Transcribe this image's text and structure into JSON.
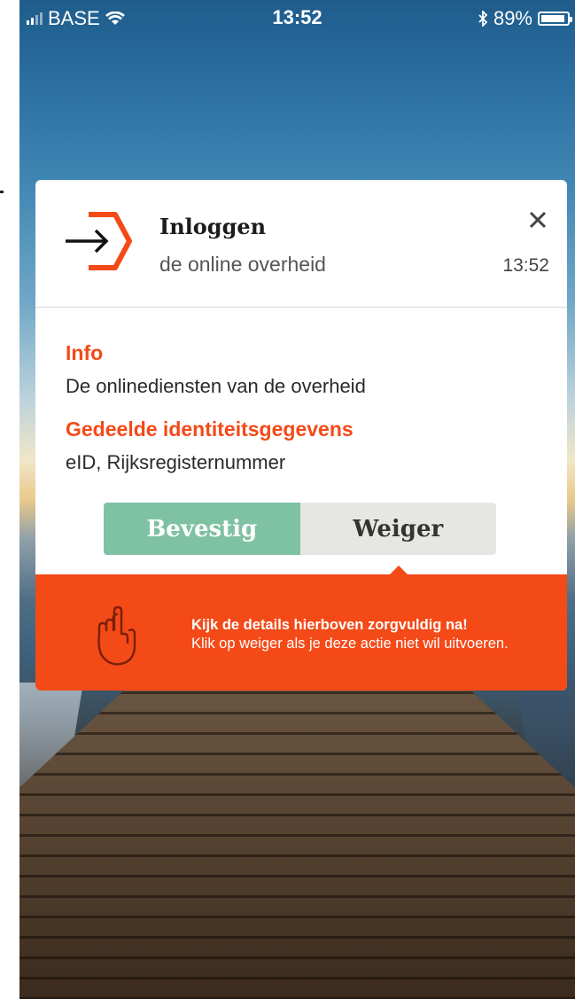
{
  "status_bar": {
    "carrier": "BASE",
    "time": "13:52",
    "battery_percent": "89%"
  },
  "notification": {
    "title": "Inloggen",
    "subtitle": "de online overheid",
    "time": "13:52",
    "close_icon": "close-icon"
  },
  "info": {
    "label": "Info",
    "text": "De onlinediensten van de overheid"
  },
  "shared": {
    "label": "Gedeelde identiteitsgegevens",
    "text": "eID, Rijksregisternummer"
  },
  "actions": {
    "confirm_label": "Bevestig",
    "deny_label": "Weiger"
  },
  "warning": {
    "title": "Kijk de details hierboven zorgvuldig na!",
    "text": "Klik op weiger als je deze actie niet wil uitvoeren."
  },
  "colors": {
    "accent": "#f34a18",
    "confirm": "#7fc1a3",
    "deny": "#e6e7e2"
  }
}
